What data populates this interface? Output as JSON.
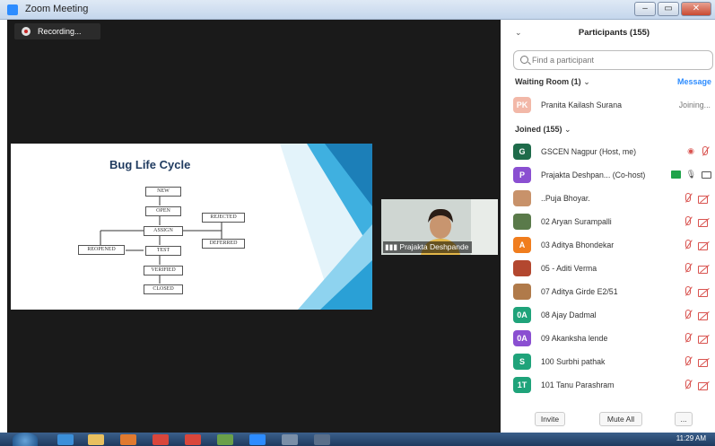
{
  "window": {
    "title": "Zoom Meeting",
    "min": "–",
    "max": "▭",
    "close": "✕"
  },
  "recording": {
    "label": "Recording..."
  },
  "slide": {
    "title": "Bug Life Cycle",
    "boxes": {
      "new": "NEW",
      "open": "OPEN",
      "assign": "ASSIGN",
      "test": "TEST",
      "verified": "VERIFIED",
      "closed": "CLOSED",
      "rejected": "REJECTED",
      "deferred": "DEFERRED",
      "reopened": "REOPENED"
    }
  },
  "thumbnail": {
    "name": "Prajakta Deshpande"
  },
  "participants": {
    "header": "Participants (155)",
    "search_placeholder": "Find a participant",
    "waiting_room": "Waiting Room (1)",
    "message": "Message",
    "waiting": [
      {
        "initials": "PK",
        "name": "Pranita Kailash Surana",
        "status": "Joining...",
        "color": "#f2b8a8"
      }
    ],
    "joined_label": "Joined (155)",
    "joined": [
      {
        "initials": "G",
        "name": "GSCEN Nagpur (Host, me)",
        "color": "#1e6b4a"
      },
      {
        "initials": "P",
        "name": "Prajakta Deshpan... (Co-host)",
        "color": "#8a4fd1"
      },
      {
        "initials": "",
        "name": "..Puja Bhoyar.",
        "color": "#c8926a"
      },
      {
        "initials": "",
        "name": "02 Aryan Surampalli",
        "color": "#5a7a4a"
      },
      {
        "initials": "A",
        "name": "03 Aditya Bhondekar",
        "color": "#f07d1e"
      },
      {
        "initials": "",
        "name": "05 - Aditi Verma",
        "color": "#b3472f"
      },
      {
        "initials": "",
        "name": "07 Aditya Girde E2/51",
        "color": "#b07a4a"
      },
      {
        "initials": "0A",
        "name": "08 Ajay Dadmal",
        "color": "#1fa37a"
      },
      {
        "initials": "0A",
        "name": "09 Akanksha lende",
        "color": "#8a4fd1"
      },
      {
        "initials": "S",
        "name": "100 Surbhi  pathak",
        "color": "#1fa37a"
      },
      {
        "initials": "1T",
        "name": "101 Tanu Parashram",
        "color": "#1fa37a"
      }
    ],
    "footer": {
      "invite": "Invite",
      "mute_all": "Mute All",
      "more": "..."
    }
  },
  "taskbar": {
    "time": "11:29 AM"
  }
}
